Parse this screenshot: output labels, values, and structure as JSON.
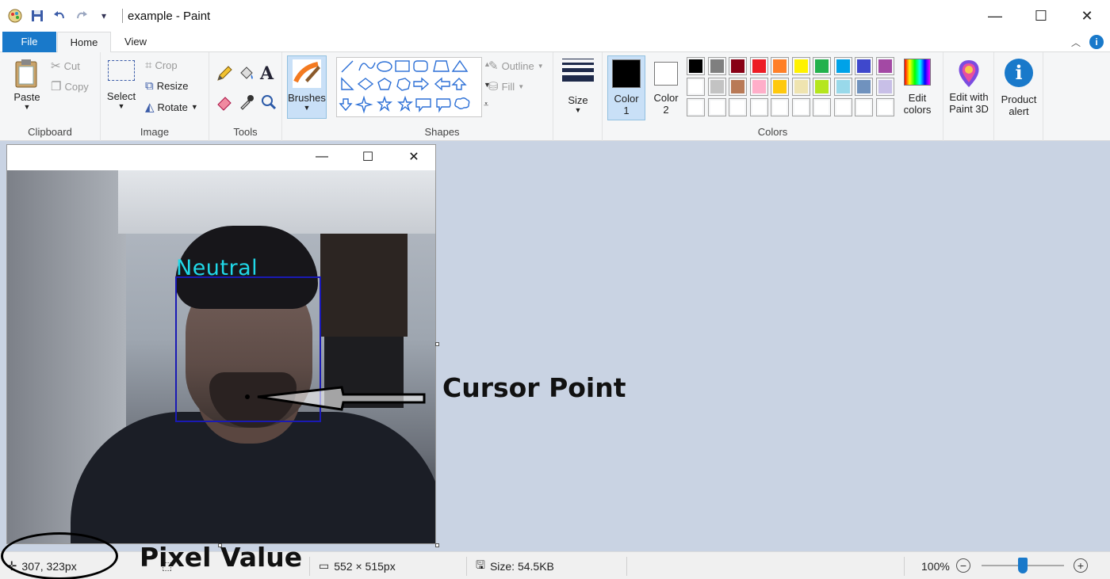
{
  "window": {
    "title": "example - Paint",
    "min_glyph": "—",
    "max_glyph": "☐",
    "close_glyph": "✕"
  },
  "quick_access": {
    "dropdown_glyph": "▾"
  },
  "tabs": [
    {
      "label": "File"
    },
    {
      "label": "Home"
    },
    {
      "label": "View"
    }
  ],
  "ribbon": {
    "collapse_glyph": "︿",
    "help_glyph": "i",
    "clipboard": {
      "group_label": "Clipboard",
      "paste_label": "Paste",
      "cut_label": "Cut",
      "copy_label": "Copy"
    },
    "image": {
      "group_label": "Image",
      "select_label": "Select",
      "crop_label": "Crop",
      "resize_label": "Resize",
      "rotate_label": "Rotate"
    },
    "tools": {
      "group_label": "Tools",
      "brushes_label": "Brushes",
      "text_glyph": "A"
    },
    "shapes": {
      "group_label": "Shapes",
      "outline_label": "Outline",
      "fill_label": "Fill"
    },
    "size": {
      "label": "Size"
    },
    "colors": {
      "group_label": "Colors",
      "color1_label": "Color",
      "color1_num": "1",
      "color2_label": "Color",
      "color2_num": "2",
      "color1_value": "#000000",
      "color2_value": "#ffffff",
      "edit_colors_line1": "Edit",
      "edit_colors_line2": "colors",
      "palette_row1": [
        "#000000",
        "#7f7f7f",
        "#880015",
        "#ed1c24",
        "#ff7f27",
        "#fff200",
        "#22b14c",
        "#00a2e8",
        "#3f48cc",
        "#a349a4"
      ],
      "palette_row2": [
        "#ffffff",
        "#c3c3c3",
        "#b97a57",
        "#ffaec9",
        "#ffc90e",
        "#efe4b0",
        "#b5e61d",
        "#99d9ea",
        "#7092be",
        "#c8bfe7"
      ],
      "palette_row3": [
        "#ffffff",
        "#ffffff",
        "#ffffff",
        "#ffffff",
        "#ffffff",
        "#ffffff",
        "#ffffff",
        "#ffffff",
        "#ffffff",
        "#ffffff"
      ]
    },
    "paint3d": {
      "line1": "Edit with",
      "line2": "Paint 3D"
    },
    "product_alert": {
      "line1": "Product",
      "line2": "alert"
    }
  },
  "canvas": {
    "emotion_label": "Neutral",
    "annotation_cursor": "Cursor Point"
  },
  "statusbar": {
    "cursor_position": "307, 323px",
    "annotation_pixel": "Pixel Value",
    "image_dimensions": "552 × 515px",
    "file_size": "Size: 54.5KB",
    "zoom": "100%",
    "zoom_level_percent": 100,
    "zoom_out_glyph": "−",
    "zoom_in_glyph": "+"
  }
}
